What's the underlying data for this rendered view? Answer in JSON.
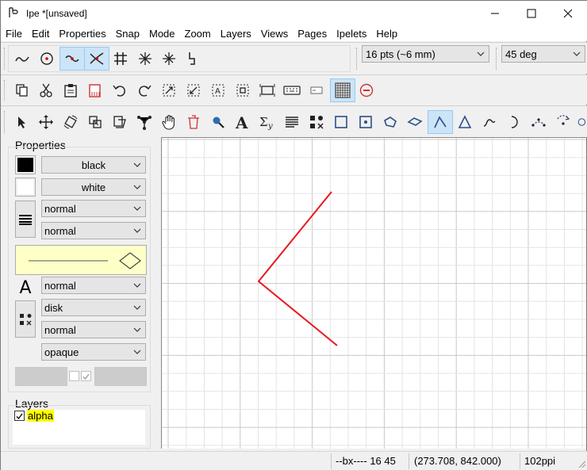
{
  "window": {
    "title": "Ipe *[unsaved]"
  },
  "menu": [
    "File",
    "Edit",
    "Properties",
    "Snap",
    "Mode",
    "Zoom",
    "Layers",
    "Views",
    "Pages",
    "Ipelets",
    "Help"
  ],
  "snap_toolbar": {
    "grid_size": "16 pts (~6 mm)",
    "angle": "45 deg"
  },
  "properties": {
    "heading": "Properties",
    "stroke_color": "black",
    "fill_color": "white",
    "pen_width": "normal",
    "dash_style": "normal",
    "text_size": "normal",
    "mark_shape": "disk",
    "mark_size": "normal",
    "opacity": "opaque"
  },
  "layers": {
    "heading": "Layers",
    "items": [
      {
        "name": "alpha",
        "checked": true
      }
    ]
  },
  "status": {
    "snap_mode": "--bx---- 16 45",
    "coords": "(273.708, 842.000)",
    "resolution": "102ppi"
  },
  "colors": {
    "stroke_swatch": "#000000",
    "fill_swatch": "#ffffff",
    "arrow_preview_bg": "#ffffc8",
    "path_color": "#e8181e",
    "layer_highlight": "#ffff00",
    "active_tool_bg": "#cce4f7"
  }
}
